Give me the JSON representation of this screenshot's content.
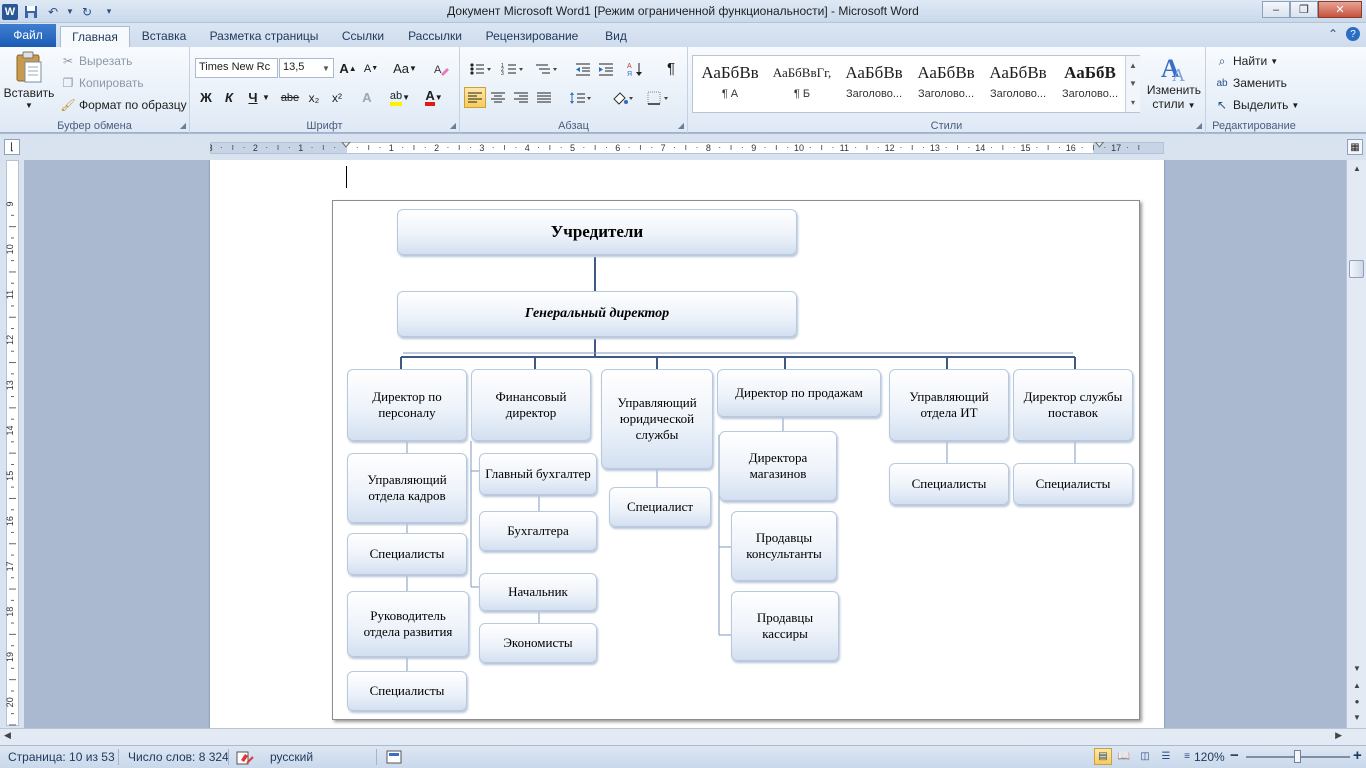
{
  "title_bar": {
    "title": "Документ Microsoft Word1 [Режим ограниченной функциональности]  -  Microsoft Word",
    "icons": [
      "word-icon",
      "save-icon",
      "undo-icon",
      "redo-icon",
      "customize-icon"
    ],
    "controls": [
      "minimize-icon",
      "maximize-icon",
      "close-icon"
    ],
    "minimize": "–",
    "maximize": "❐",
    "close": "✕"
  },
  "tabs": [
    {
      "label": "Файл"
    },
    {
      "label": "Главная"
    },
    {
      "label": "Вставка"
    },
    {
      "label": "Разметка страницы"
    },
    {
      "label": "Ссылки"
    },
    {
      "label": "Рассылки"
    },
    {
      "label": "Рецензирование"
    },
    {
      "label": "Вид"
    }
  ],
  "active_tab": "Главная",
  "ribbon": {
    "clipboard": {
      "paste": "Вставить",
      "cut": "Вырезать",
      "copy": "Копировать",
      "format_painter": "Формат по образцу",
      "label": "Буфер обмена"
    },
    "font": {
      "font_name": "Times New Rc",
      "font_size": "13,5",
      "grow": "A",
      "shrink": "A",
      "change_case": "Aa",
      "bold": "Ж",
      "italic": "К",
      "underline": "Ч",
      "strike": "abe",
      "subscript": "x₂",
      "superscript": "x²",
      "font_color": "A",
      "highlight": "ab",
      "label": "Шрифт"
    },
    "paragraph": {
      "label": "Абзац",
      "pilcrow": "¶"
    },
    "styles": {
      "label": "Стили",
      "items": [
        {
          "sample": "АаБбВв",
          "name": "¶ А"
        },
        {
          "sample": "АаБбВвГг,",
          "name": "¶ Б"
        },
        {
          "sample": "АаБбВв",
          "name": "Заголово..."
        },
        {
          "sample": "АаБбВв",
          "name": "Заголово..."
        },
        {
          "sample": "АаБбВв",
          "name": "Заголово..."
        },
        {
          "sample": "АаБбВ",
          "name": "Заголово..."
        }
      ],
      "change_styles_line1": "Изменить",
      "change_styles_line2": "стили"
    },
    "editing": {
      "find": "Найти",
      "replace": "Заменить",
      "select": "Выделить",
      "label": "Редактирование"
    }
  },
  "ruler": {
    "h_numbers": [
      "3",
      "2",
      "1",
      "1",
      "2",
      "3",
      "4",
      "5",
      "6",
      "7",
      "8",
      "9",
      "10",
      "11",
      "12",
      "13",
      "14",
      "15",
      "16",
      "17"
    ],
    "v_numbers": [
      "9",
      "10",
      "11",
      "12",
      "13",
      "14",
      "15",
      "16",
      "17",
      "18",
      "19",
      "20"
    ]
  },
  "orgchart": {
    "root": "Учредители",
    "ceo": "Генеральный директор",
    "nodes": {
      "hr_director": "Директор по персоналу",
      "hr_manager": "Управляющий отдела кадров",
      "hr_specialists": "Специалисты",
      "dev_head": "Руководитель отдела развития",
      "dev_specialists": "Специалисты",
      "cfo": "Финансовый директор",
      "chief_accountant": "Главный  бухгалтер",
      "accountants": "Бухгалтера",
      "chief": "Начальник",
      "economists": "Экономисты",
      "legal_manager": "Управляющий юридической службы",
      "legal_specialist": "Специалист",
      "sales_director": "Директор  по продажам",
      "store_directors": "Директора магазинов",
      "sales_consultants": "Продавцы консультанты",
      "cashiers": "Продавцы кассиры",
      "it_manager": "Управляющий отдела ИТ",
      "it_specialists": "Специалисты",
      "supply_director": "Директор службы поставок",
      "supply_specialists": "Специалисты"
    }
  },
  "status_bar": {
    "page": "Страница: 10 из 53",
    "words": "Число слов: 8 324",
    "language": "русский",
    "zoom": "120%",
    "zoom_minus": "−",
    "zoom_plus": "+"
  },
  "colors": {
    "accent": "#2b579a",
    "file_tab": "#2a65be",
    "node_fill": "#d3e0f1",
    "connector": "#3e5a82"
  }
}
